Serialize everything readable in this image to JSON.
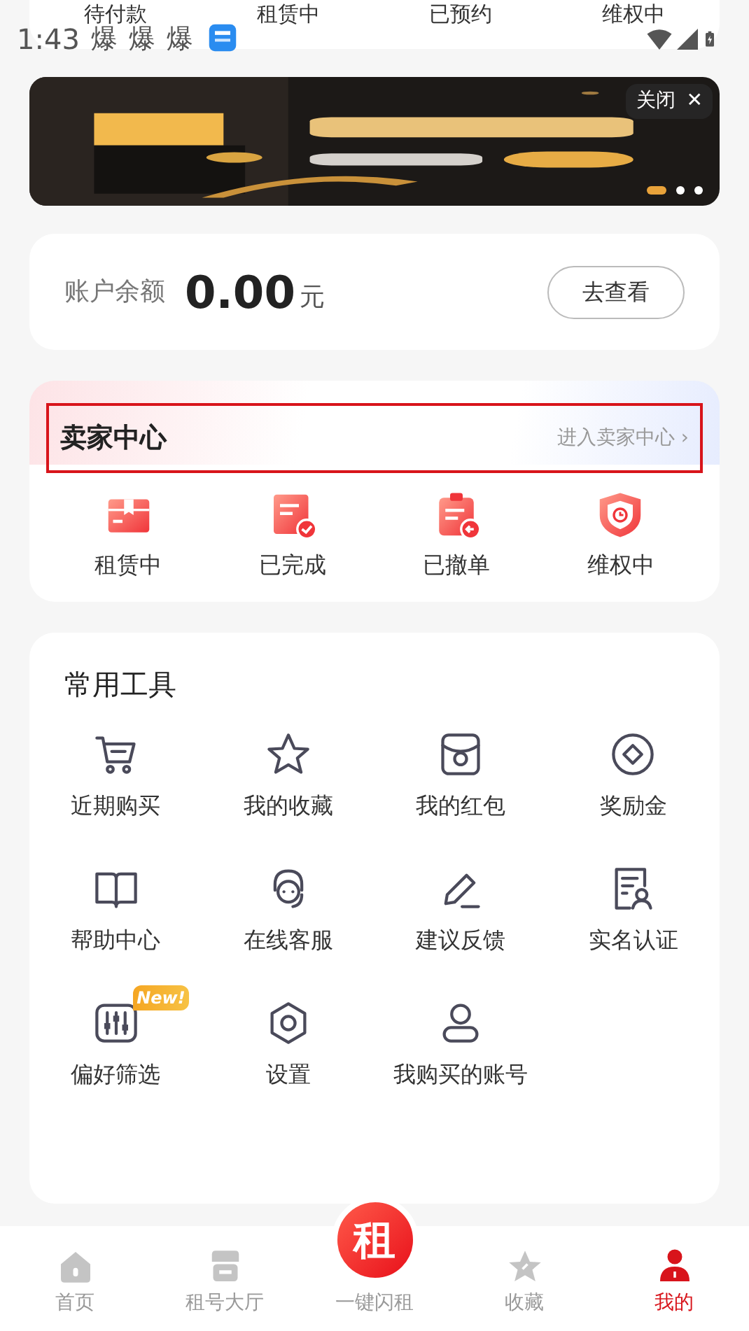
{
  "status_bar": {
    "time": "1:43",
    "notifications": [
      "爆",
      "爆",
      "爆"
    ]
  },
  "order_tabs": [
    "待付款",
    "租赁中",
    "已预约",
    "维权中"
  ],
  "banner": {
    "close_label": "关闭",
    "close_glyph": "✕",
    "dots": [
      {
        "selected": true
      },
      {
        "selected": false
      },
      {
        "selected": false
      }
    ]
  },
  "balance": {
    "label": "账户余额",
    "amount": "0.00",
    "unit": "元",
    "button": "去查看"
  },
  "seller_center": {
    "title": "卖家中心",
    "link": "进入卖家中心",
    "chevron": "›",
    "highlighted": true,
    "items": [
      "租赁中",
      "已完成",
      "已撤单",
      "维权中"
    ]
  },
  "tools": {
    "title": "常用工具",
    "items": [
      {
        "label": "近期购买"
      },
      {
        "label": "我的收藏"
      },
      {
        "label": "我的红包"
      },
      {
        "label": "奖励金"
      },
      {
        "label": "帮助中心"
      },
      {
        "label": "在线客服"
      },
      {
        "label": "建议反馈"
      },
      {
        "label": "实名认证"
      },
      {
        "label": "偏好筛选",
        "badge": "New!"
      },
      {
        "label": "设置"
      },
      {
        "label": "我购买的账号"
      }
    ]
  },
  "bottom_nav": [
    {
      "label": "首页",
      "selected": false
    },
    {
      "label": "租号大厅",
      "selected": false
    },
    {
      "label": "一键闪租",
      "selected": false,
      "kind": "center",
      "glyph": "租"
    },
    {
      "label": "收藏",
      "selected": false
    },
    {
      "label": "我的",
      "selected": true
    }
  ]
}
